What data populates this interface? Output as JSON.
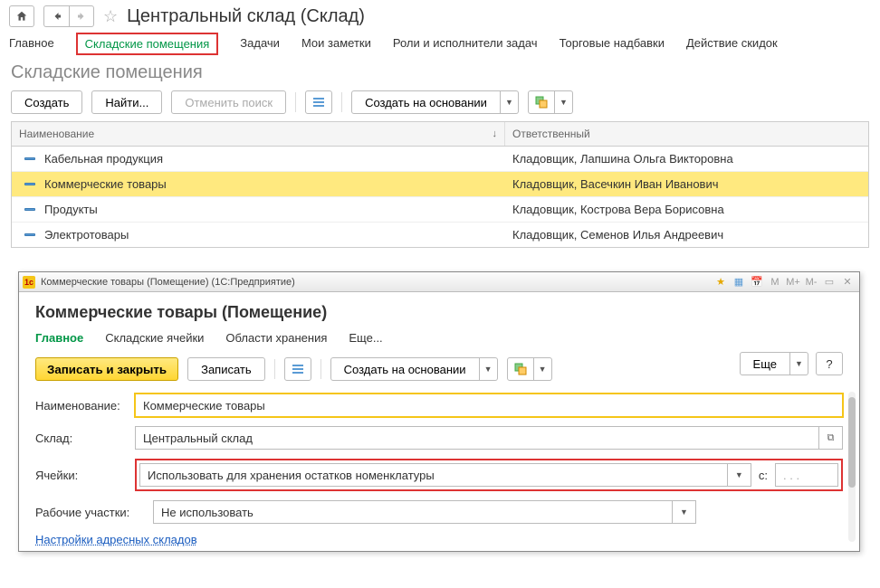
{
  "page_title": "Центральный склад (Склад)",
  "nav_tabs": {
    "main": "Главное",
    "storage_rooms": "Складские помещения",
    "tasks": "Задачи",
    "my_notes": "Мои заметки",
    "roles": "Роли и исполнители задач",
    "markups": "Торговые надбавки",
    "discounts": "Действие скидок"
  },
  "section_title": "Складские помещения",
  "toolbar": {
    "create": "Создать",
    "find": "Найти...",
    "cancel_search": "Отменить поиск",
    "create_based_on": "Создать на основании"
  },
  "table": {
    "col_name": "Наименование",
    "col_responsible": "Ответственный",
    "rows": [
      {
        "name": "Кабельная продукция",
        "resp": "Кладовщик, Лапшина Ольга Викторовна"
      },
      {
        "name": "Коммерческие товары",
        "resp": "Кладовщик, Васечкин Иван Иванович"
      },
      {
        "name": "Продукты",
        "resp": "Кладовщик, Кострова Вера Борисовна"
      },
      {
        "name": "Электротовары",
        "resp": "Кладовщик, Семенов Илья Андреевич"
      }
    ]
  },
  "dialog": {
    "title": "Коммерческие товары (Помещение)  (1С:Предприятие)",
    "heading": "Коммерческие товары (Помещение)",
    "tabs": {
      "main": "Главное",
      "cells": "Складские ячейки",
      "areas": "Области хранения",
      "more": "Еще..."
    },
    "buttons": {
      "save_close": "Записать и закрыть",
      "save": "Записать",
      "create_based_on": "Создать на основании",
      "more": "Еще",
      "help": "?"
    },
    "labels": {
      "name": "Наименование:",
      "warehouse": "Склад:",
      "cells": "Ячейки:",
      "c": "с:",
      "work_areas": "Рабочие участки:"
    },
    "values": {
      "name": "Коммерческие товары",
      "warehouse": "Центральный склад",
      "cells": "Использовать для хранения остатков номенклатуры",
      "c": ". . .",
      "work_areas": "Не использовать"
    },
    "link_address_settings": "Настройки адресных складов",
    "win_icons": {
      "m": "M",
      "mp": "M+",
      "mm": "M-"
    }
  }
}
